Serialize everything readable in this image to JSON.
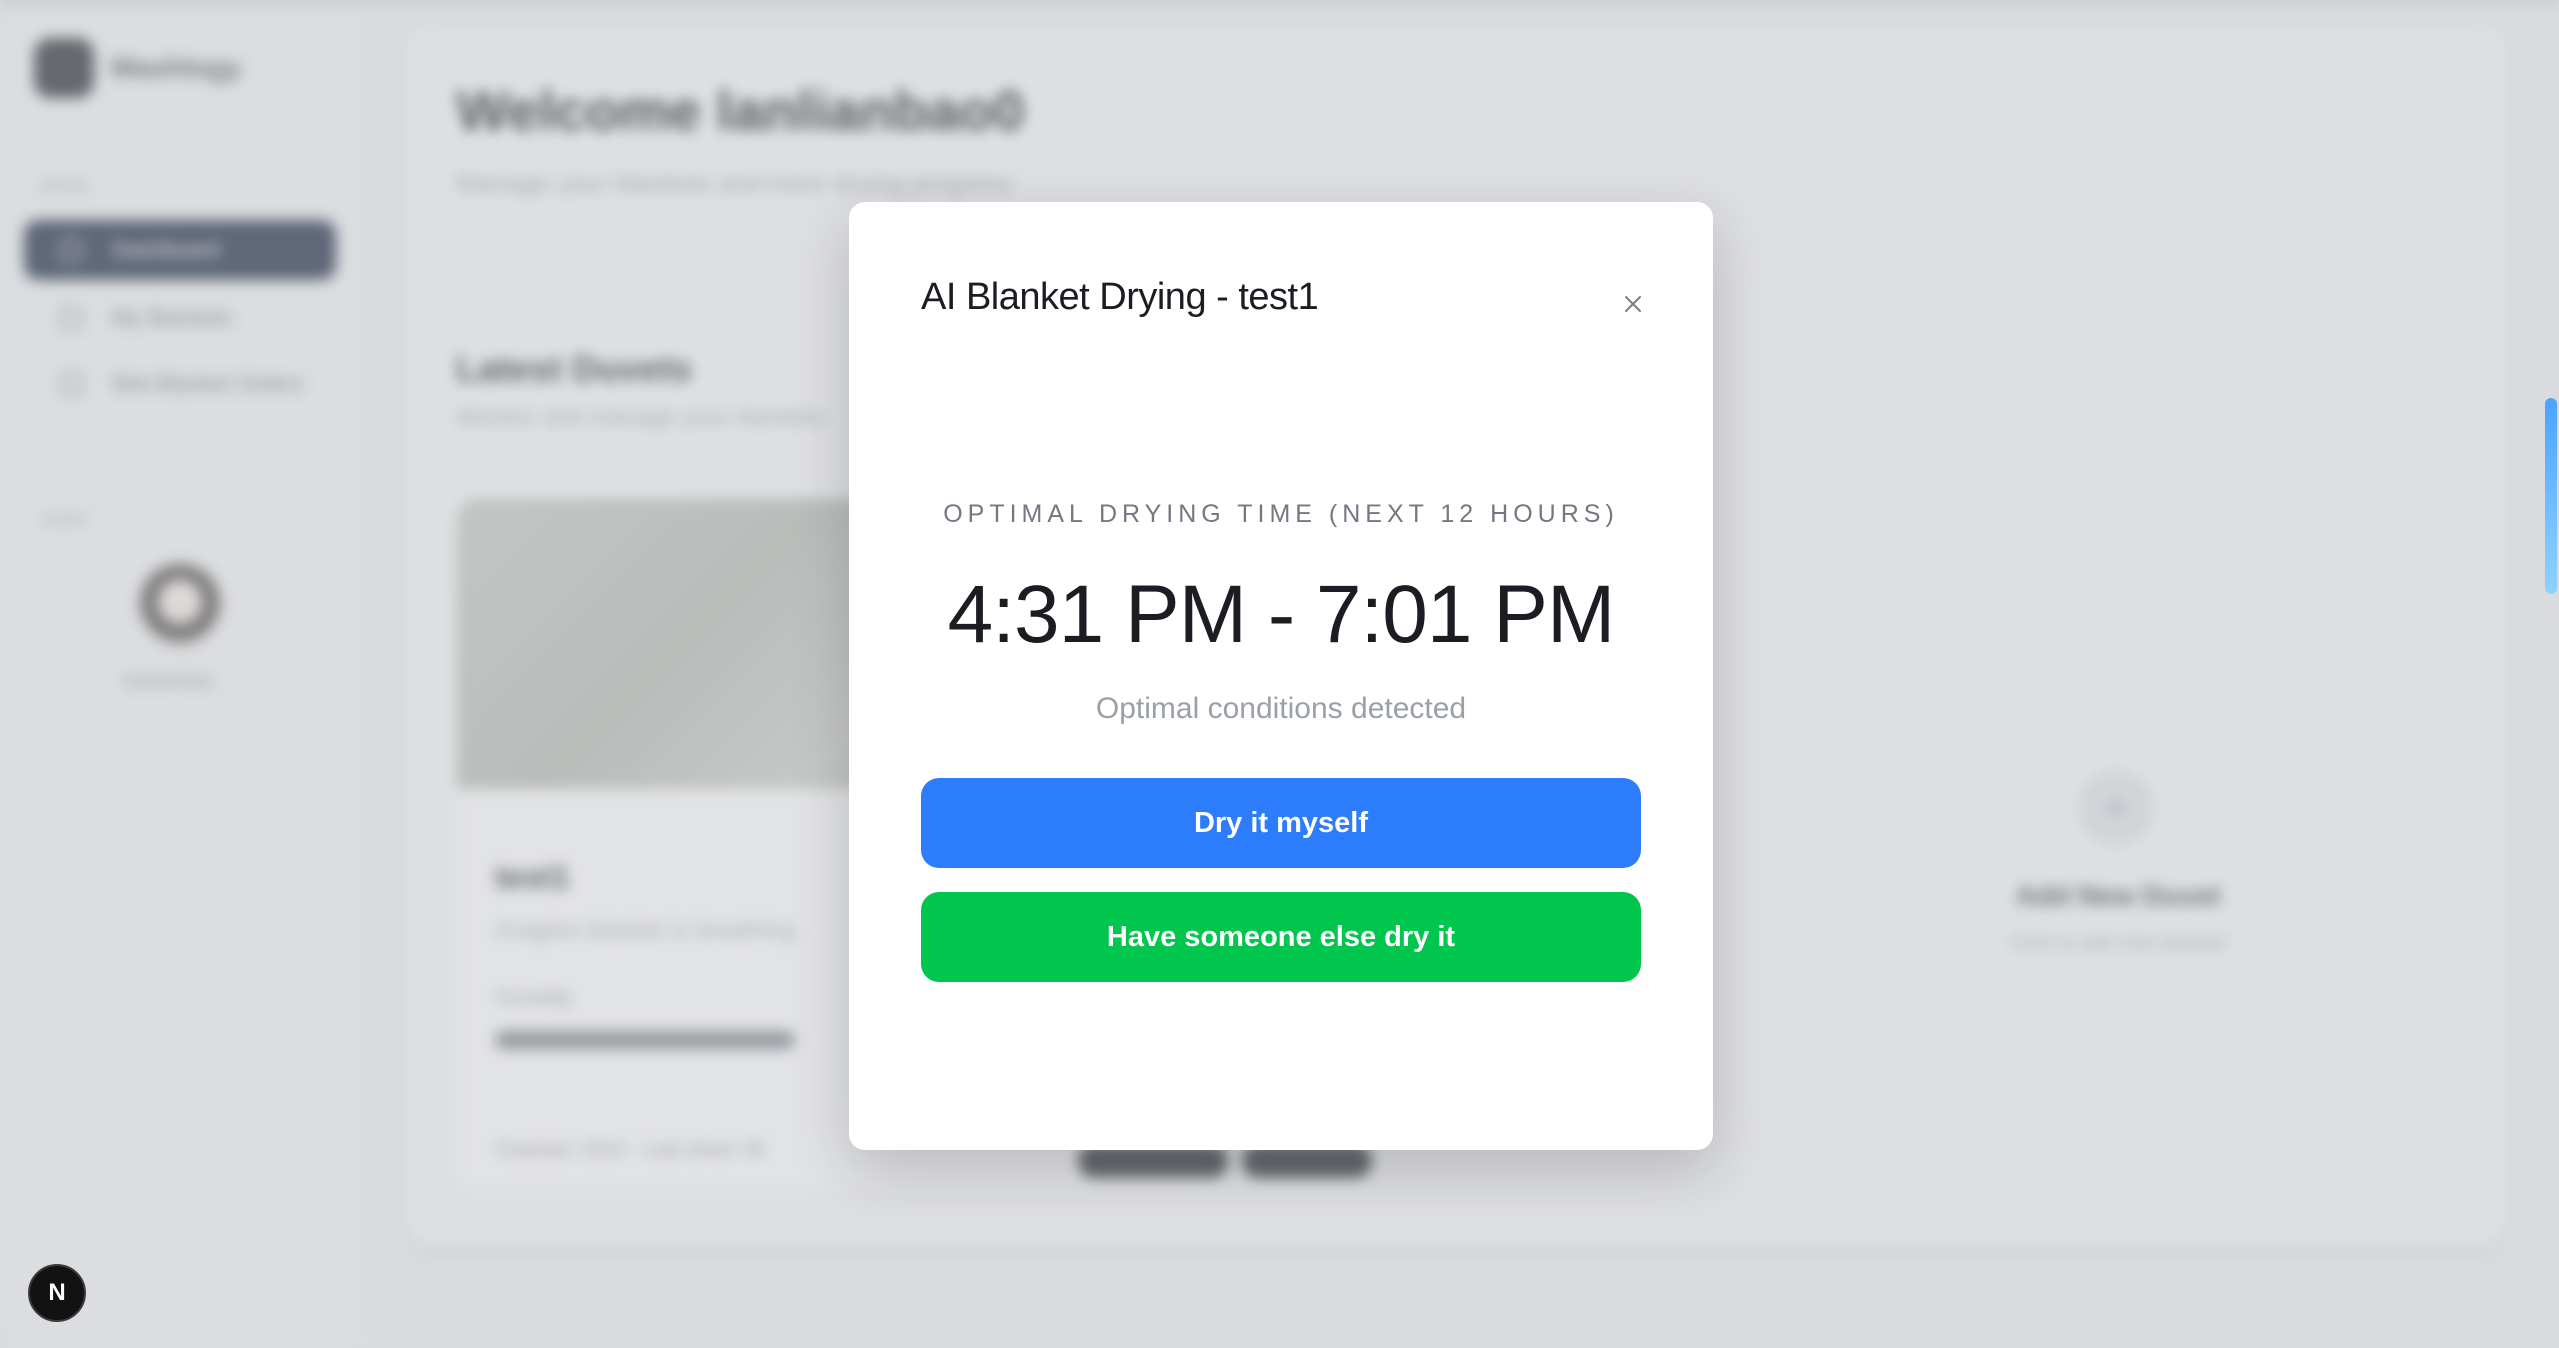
{
  "background": {
    "logo_text": "Washlogy",
    "nav_section_label": "MENU",
    "nav_items": [
      {
        "label": "Dashboard",
        "active": true
      },
      {
        "label": "My Blankets",
        "active": false
      },
      {
        "label": "Wet Blanket Orders",
        "active": false
      }
    ],
    "user_section_label": "USER",
    "user_name": "lowlanbao",
    "welcome_title": "Welcome lanlianbao0",
    "welcome_subtitle": "Manage your blankets and track drying progress",
    "section_title": "Latest Duvets",
    "section_subtitle": "Monitor and manage your blankets",
    "card": {
      "title": "test1",
      "subtitle": "Imagine blanket is breathing",
      "progress_label": "Humidity",
      "progress_value": 0.6,
      "footer": "Cleaned: 2024 · Last dried: 09"
    },
    "add_card": {
      "plus": "+",
      "title": "Add New Duvet",
      "subtitle": "Click to add new blanket"
    }
  },
  "modal": {
    "title": "AI Blanket Drying - test1",
    "close_icon": "close-icon",
    "eyebrow": "OPTIMAL DRYING TIME (NEXT 12 HOURS)",
    "time_range": "4:31 PM - 7:01 PM",
    "status": "Optimal conditions detected",
    "primary_button": "Dry it myself",
    "secondary_button": "Have someone else dry it",
    "colors": {
      "primary": "#2d7cfb",
      "secondary": "#00c64d"
    }
  },
  "dev_badge": "N"
}
